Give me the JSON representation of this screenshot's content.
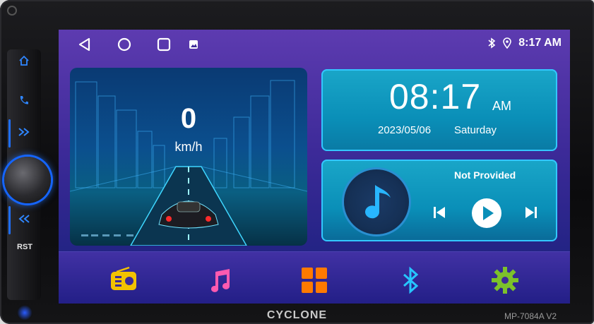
{
  "status": {
    "time": "8:17 AM"
  },
  "speedometer": {
    "value": "0",
    "unit": "km/h"
  },
  "clock": {
    "time": "08:17",
    "ampm": "AM",
    "date": "2023/05/06",
    "day": "Saturday"
  },
  "music": {
    "title": "Not Provided"
  },
  "device": {
    "brand": "CYCLONE",
    "model": "MP-7084A V2",
    "rst_label": "RST"
  },
  "colors": {
    "accent_blue": "#2f86ff",
    "radio_yellow": "#f2c200",
    "music_pink": "#ff5ab0",
    "apps_orange": "#ff7a00",
    "bluetooth_cyan": "#26c6ff",
    "settings_green": "#7cc12a"
  },
  "icons": {
    "nav": [
      "back-triangle-icon",
      "home-circle-icon",
      "recents-square-icon",
      "gallery-icon"
    ],
    "status": [
      "bluetooth-icon",
      "location-pin-icon"
    ],
    "side": [
      "home-icon",
      "phone-icon",
      "next-icon",
      "previous-icon"
    ],
    "dock": [
      "radio-icon",
      "music-note-icon",
      "apps-grid-icon",
      "bluetooth-icon",
      "settings-gear-icon"
    ]
  }
}
